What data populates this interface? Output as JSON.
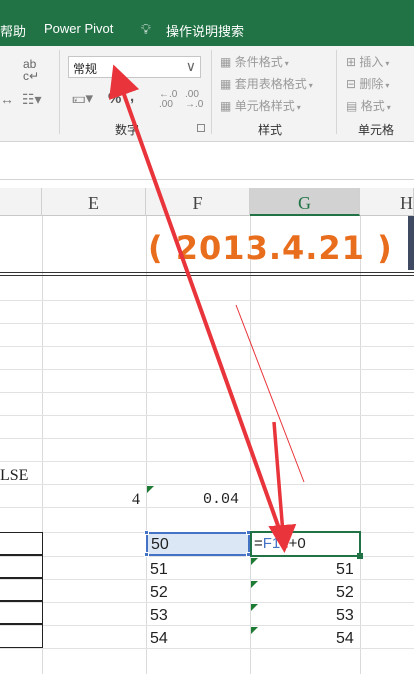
{
  "menu": {
    "help": "帮助",
    "power_pivot": "Power Pivot",
    "search": "操作说明搜索"
  },
  "ribbon": {
    "number_format_value": "常规",
    "group_number": "数字",
    "group_styles": "样式",
    "group_cells": "单元格",
    "conditional_format": "条件格式",
    "table_format": "套用表格格式",
    "cell_styles": "单元格样式",
    "insert": "插入",
    "delete": "删除",
    "format": "格式",
    "percent": "%",
    "comma": ","
  },
  "columns": [
    "E",
    "F",
    "G",
    "H"
  ],
  "sheet": {
    "date_banner": "( 2013.4.21 )",
    "false_text": "LSE",
    "val_4": "4",
    "val_004": "0.04",
    "active_value": "50",
    "formula_ref": "F19",
    "formula_prefix": "=",
    "formula_suffix": "+0",
    "f_values": [
      "51",
      "52",
      "53",
      "54"
    ],
    "g_values": [
      "51",
      "52",
      "53",
      "54"
    ]
  },
  "colors": {
    "excel_green": "#217346",
    "banner_orange": "#e86d1c",
    "selection_blue": "#4472c4",
    "arrow_red": "#e8343a"
  }
}
